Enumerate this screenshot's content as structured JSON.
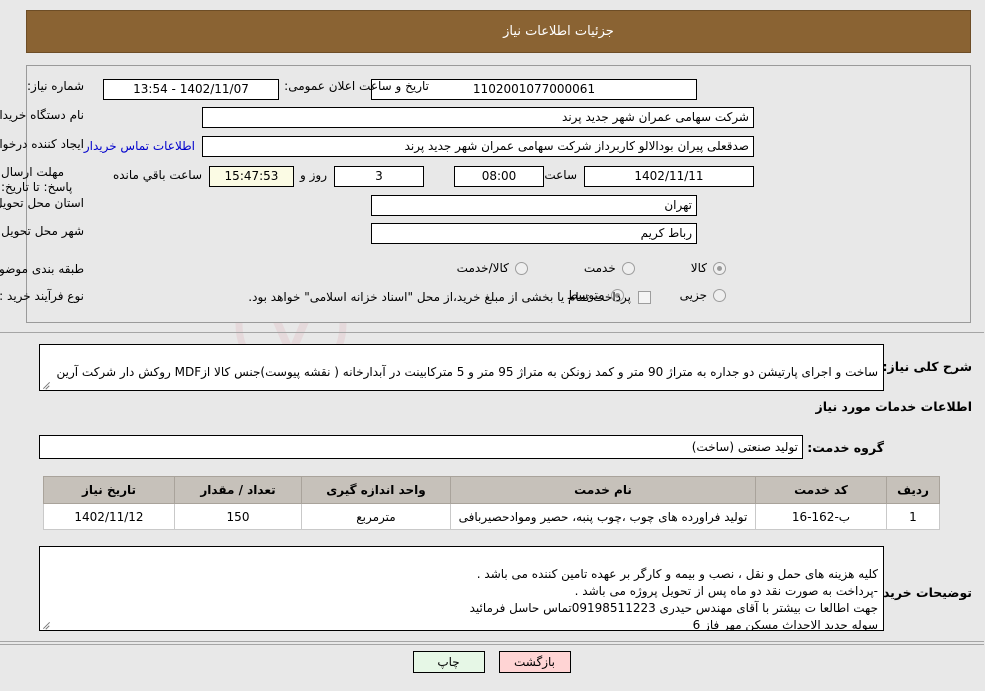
{
  "header": {
    "title": "جزئیات اطلاعات نیاز"
  },
  "form": {
    "need_number_label": "شماره نیاز:",
    "need_number_value": "1102001077000061",
    "public_announce_label": "تاریخ و ساعت اعلان عمومی:",
    "public_announce_value": "1402/11/07 - 13:54",
    "buyer_org_label": "نام دستگاه خریدار:",
    "buyer_org_value": "شرکت سهامی عمران شهر جدید پرند",
    "requester_label": "ایجاد کننده درخواست:",
    "requester_value": "صدقعلی پیران بودالالو کاربرداز شرکت سهامی عمران شهر جدید پرند",
    "buyer_contact_link": "اطلاعات تماس خریدار",
    "deadline_label": "مهلت ارسال پاسخ: تا تاریخ:",
    "deadline_date": "1402/11/11",
    "hour_label": "ساعت",
    "deadline_time": "08:00",
    "days_remaining": "3",
    "days_and_label": "روز و",
    "time_remaining": "15:47:53",
    "hours_remaining_label": "ساعت باقي مانده",
    "province_label": "استان محل تحویل:",
    "province_value": "تهران",
    "city_label": "شهر محل تحویل:",
    "city_value": "رباط کریم",
    "category_label": "طبقه بندی موضوعی:",
    "category_options": [
      {
        "label": "کالا",
        "selected": true
      },
      {
        "label": "خدمت",
        "selected": false
      },
      {
        "label": "کالا/خدمت",
        "selected": false
      }
    ],
    "process_label": "نوع فرآیند خرید :",
    "process_options": [
      {
        "label": "جزیی",
        "selected": false
      },
      {
        "label": "متوسط",
        "selected": true
      }
    ],
    "treasury_note": "پرداخت تمام یا بخشی از مبلغ خرید،از محل \"اسناد خزانه اسلامی\" خواهد بود."
  },
  "description": {
    "label": "شرح کلی نیاز:",
    "value": "ساخت و اجرای پارتیشن دو جداره به متراژ 90 متر و کمد زونکن به متراژ 95 متر و 5 مترکابینت در آبدارخانه ( نقشه پیوست)جنس کالا ازMDF روکش دار شرکت آرین"
  },
  "services_section": {
    "title": "اطلاعات خدمات مورد نیاز",
    "group_label": "گروه خدمت:",
    "group_value": "تولید صنعتی (ساخت)"
  },
  "table": {
    "columns": [
      "ردیف",
      "کد خدمت",
      "نام خدمت",
      "واحد اندازه گیری",
      "تعداد / مقدار",
      "تاریخ نیاز"
    ],
    "rows": [
      {
        "row_no": "1",
        "service_code": "ب-162-16",
        "service_name": "تولید فراورده های چوب ،چوب پنبه، حصیر وموادحصیربافی",
        "unit": "مترمربع",
        "quantity": "150",
        "need_date": "1402/11/12"
      }
    ]
  },
  "buyer_notes": {
    "label": "توضیحات خریدار:",
    "value": "کلیه هزینه های حمل و نقل ، نصب و بیمه و کارگر بر عهده تامین کننده می باشد .\n-پرداخت به صورت نقد دو ماه پس از تحویل پروژه می باشد .\nجهت اطالعا ت بیشتر با آقای مهندس حیدری 09198511223تماس حاسل فرمائید\nسوله جدید الاحداث مسکن مهر فاز 6"
  },
  "footer": {
    "print_label": "چاپ",
    "back_label": "بازگشت"
  },
  "colors": {
    "header_bg": "#8a6333",
    "header_text": "#ffffff",
    "link": "#0000cc",
    "table_header_bg": "#c6c1ba",
    "print_btn_bg": "#e6f7e6",
    "back_btn_bg": "#ffd4d4",
    "highlight_field_bg": "#fbfbe4"
  },
  "watermark": {
    "text": "AriaTender.net"
  }
}
